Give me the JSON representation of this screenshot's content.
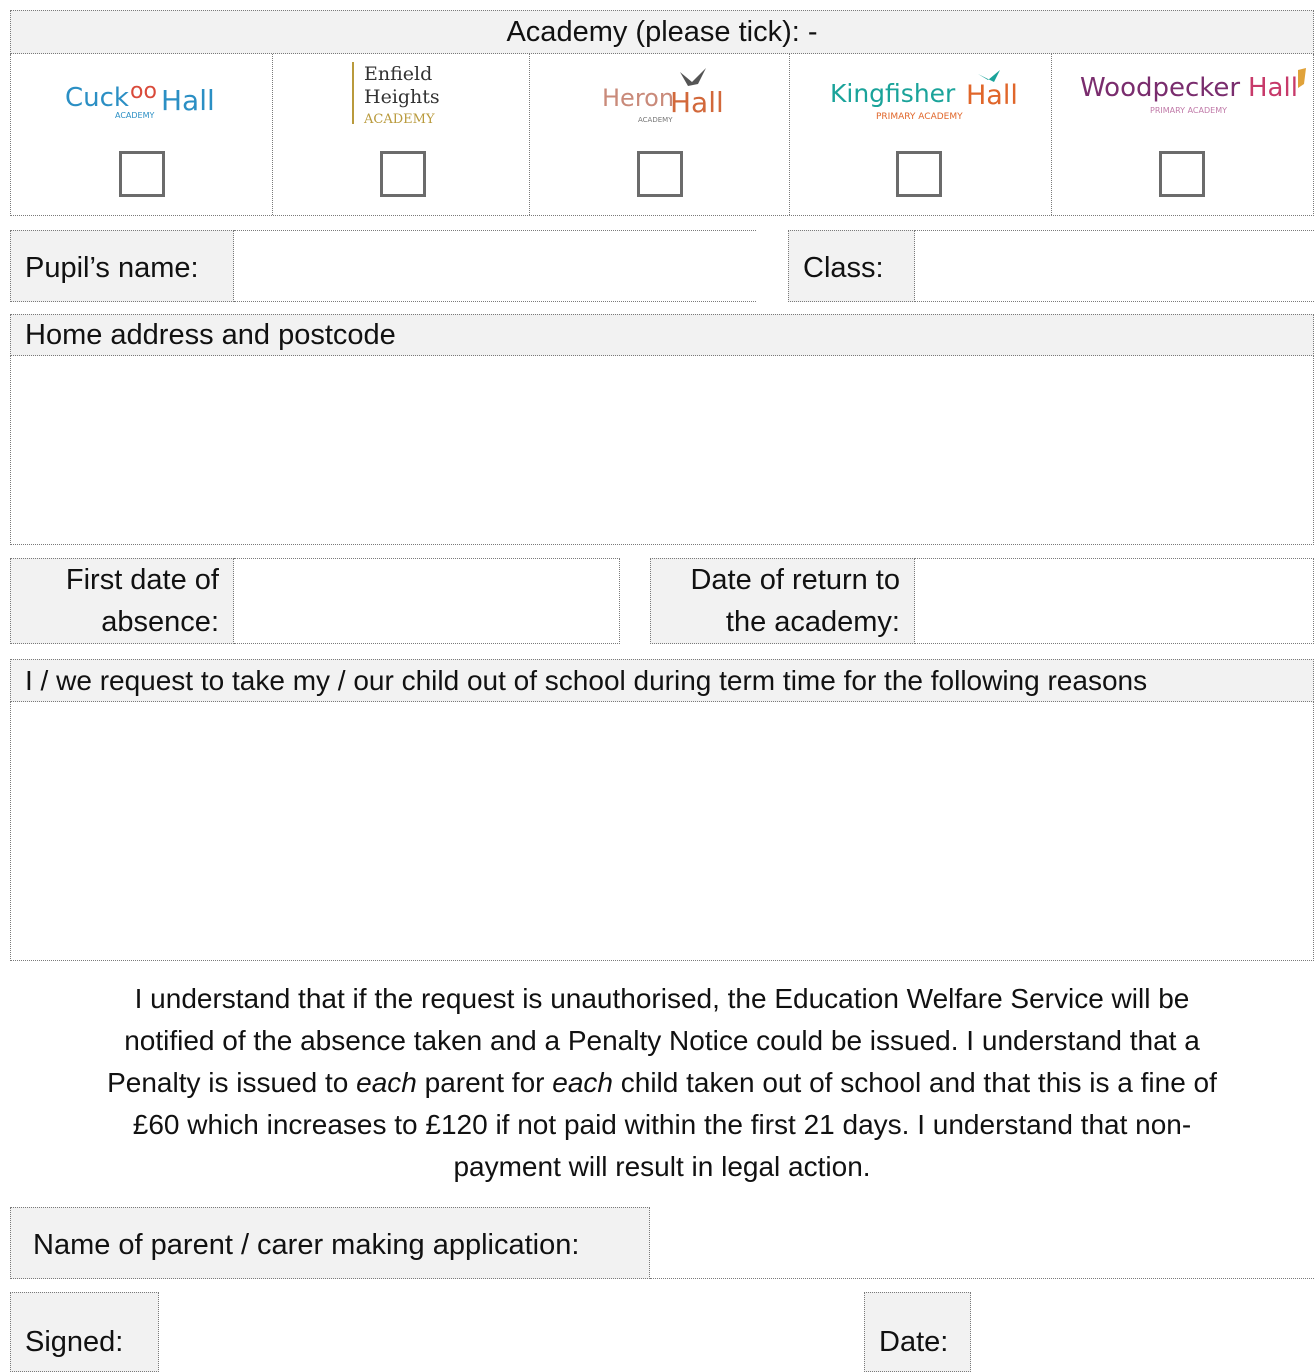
{
  "academy": {
    "heading": "Academy (please tick): -",
    "schools": [
      {
        "name": "Cuckoo Hall",
        "sub": "ACADEMY",
        "checked": false
      },
      {
        "name": "Enfield Heights Academy",
        "line1": "Enfield",
        "line2": "Heights",
        "line3": "ACADEMY",
        "checked": false
      },
      {
        "name": "Heron Hall",
        "sub": "ACADEMY",
        "checked": false
      },
      {
        "name": "Kingfisher Hall",
        "sub": "PRIMARY ACADEMY",
        "checked": false
      },
      {
        "name": "Woodpecker Hall",
        "sub": "PRIMARY ACADEMY",
        "checked": false
      }
    ]
  },
  "fields": {
    "pupil_name_label": "Pupil’s name:",
    "pupil_name_value": "",
    "class_label": "Class:",
    "class_value": "",
    "address_label": "Home address and postcode",
    "address_value": "",
    "first_date_label_1": "First date of",
    "first_date_label_2": "absence:",
    "first_date_value": "",
    "return_date_label_1": "Date of return to",
    "return_date_label_2": "the academy:",
    "return_date_value": "",
    "reasons_label": "I / we request to take my / our child out of school during term time for the following reasons",
    "reasons_value": "",
    "parent_label": "Name of parent / carer making application:",
    "parent_value": "",
    "signed_label": "Signed:",
    "signed_value": "",
    "date_label": "Date:",
    "date_value": ""
  },
  "declaration": {
    "line1": "I understand that if the request is unauthorised, the Education Welfare Service will be",
    "line2": "notified of the absence taken and a Penalty Notice could be issued.  I understand that a",
    "line3_a": "Penalty is issued to ",
    "line3_b": "each",
    "line3_c": " parent for ",
    "line3_d": "each",
    "line3_e": " child taken out of school and that this is a fine of",
    "line4": "£60 which increases to £120 if not paid within the first 21 days.  I understand that non-",
    "line5": "payment will result in legal action."
  },
  "colors": {
    "label_bg": "#f2f2f2",
    "border": "#7a7a7a",
    "cuckoo": "#2b8fc4",
    "enfield_gold": "#b99a3c",
    "heron": "#c98a7a",
    "kingfisher": "#1aa39a",
    "woodpecker": "#7a2d6e"
  }
}
